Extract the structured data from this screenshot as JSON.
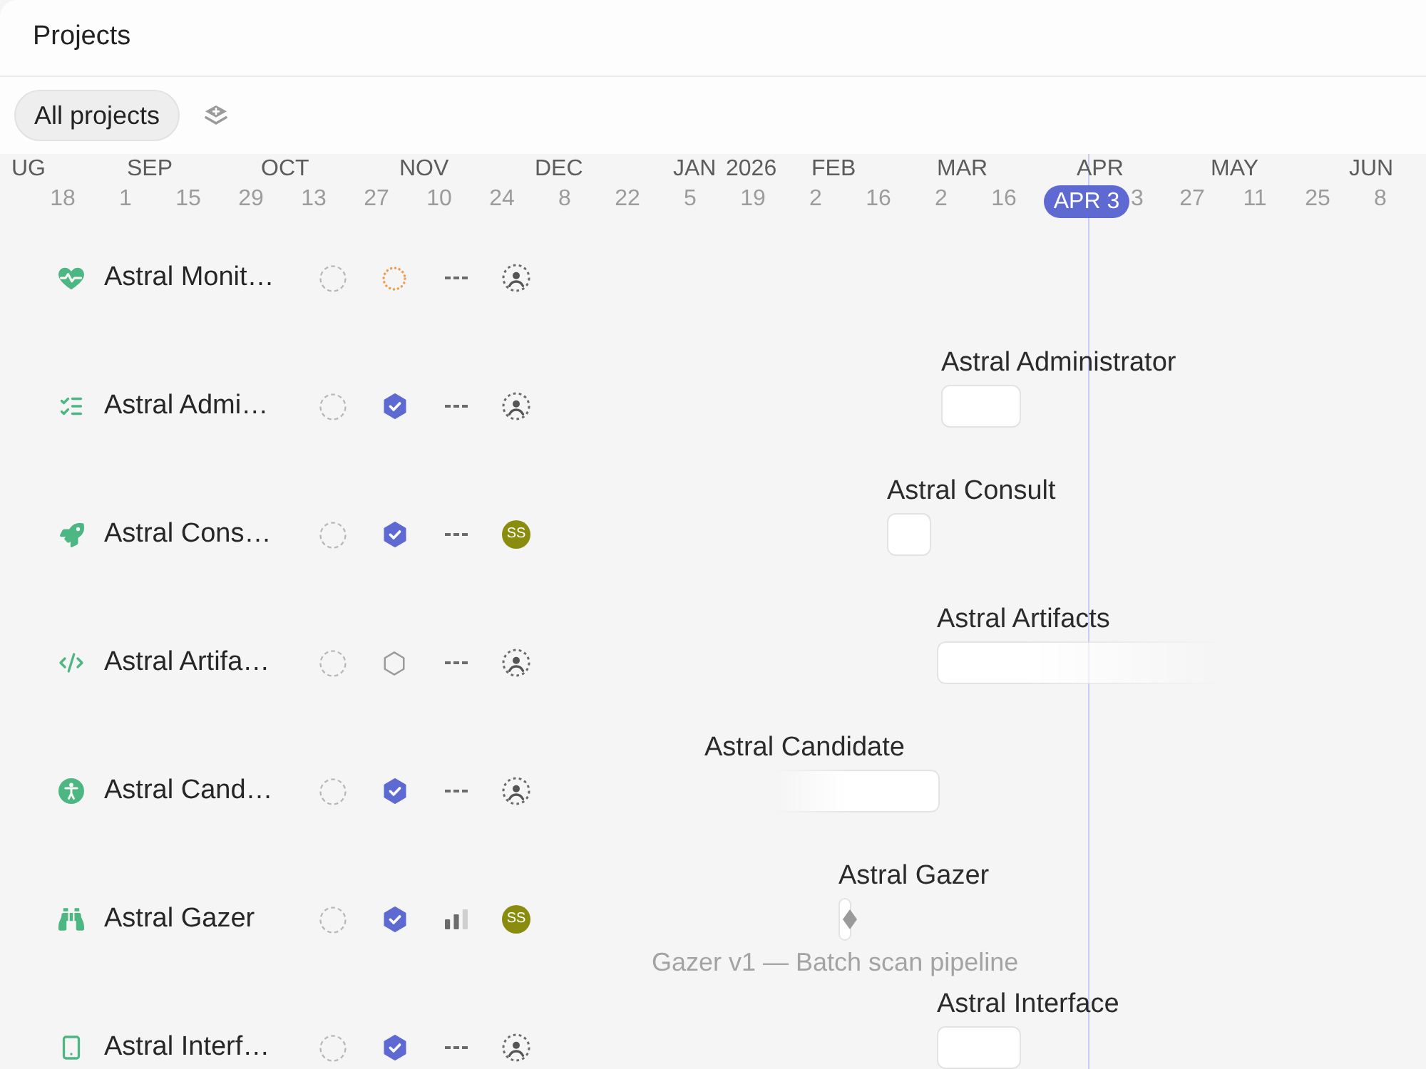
{
  "header": {
    "title": "Projects"
  },
  "toolbar": {
    "view_tab": {
      "label": "All projects",
      "selected": true
    }
  },
  "timeline": {
    "months": [
      "UG",
      "SEP",
      "OCT",
      "NOV",
      "DEC",
      "JAN",
      "FEB",
      "MAR",
      "APR",
      "MAY",
      "JUN"
    ],
    "year": "2026",
    "days": [
      "18",
      "1",
      "15",
      "29",
      "13",
      "27",
      "10",
      "24",
      "8",
      "22",
      "5",
      "19",
      "2",
      "16",
      "2",
      "16",
      "3",
      "27",
      "11",
      "25",
      "8"
    ],
    "today": "APR 3"
  },
  "projects": [
    {
      "name": "Astral Monit…",
      "completed": false,
      "planned": true
    },
    {
      "name": "Astral Admi…",
      "completed": true,
      "bar": {
        "label": "Astral Administrator"
      }
    },
    {
      "name": "Astral Cons…",
      "completed": true,
      "lead": "SS",
      "bar": {
        "label": "Astral Consult"
      }
    },
    {
      "name": "Astral Artifa…",
      "completed": false,
      "planned": false,
      "bar": {
        "label": "Astral Artifacts",
        "fade_end": true
      }
    },
    {
      "name": "Astral Cand…",
      "completed": true,
      "bar": {
        "label": "Astral Candidate",
        "fade_start": true
      }
    },
    {
      "name": "Astral Gazer",
      "completed": true,
      "priority": {
        "level": 0.67
      },
      "lead": "SS",
      "bar": {
        "label": "Astral Gazer",
        "milestone": "Gazer v1 — Batch scan pipeline"
      }
    },
    {
      "name": "Astral Interf…",
      "completed": true,
      "bar": {
        "label": "Astral Interface"
      }
    }
  ]
}
